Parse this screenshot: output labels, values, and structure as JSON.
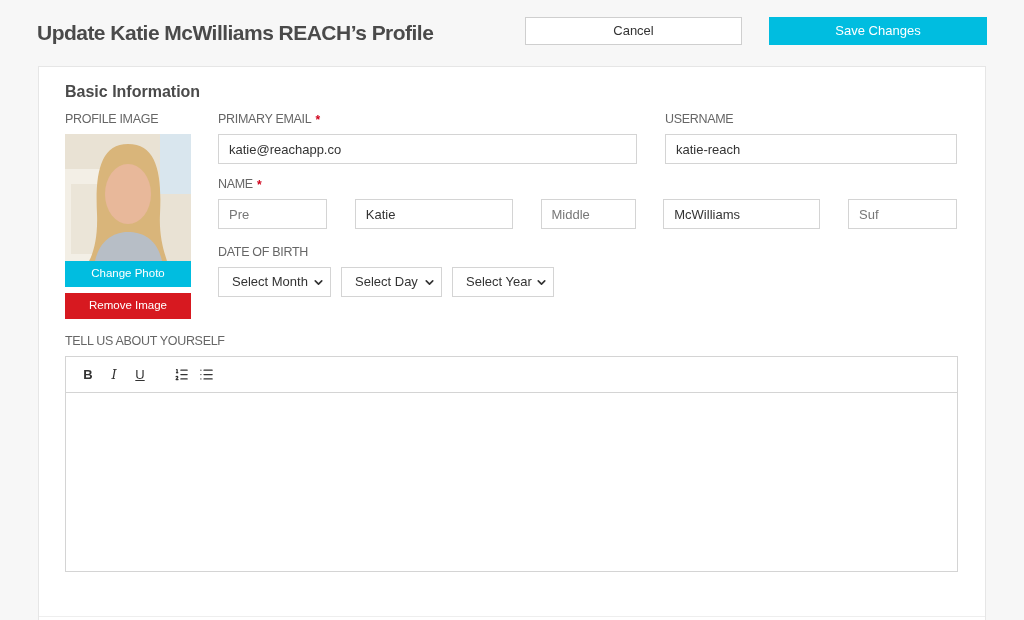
{
  "page": {
    "title": "Update Katie McWilliams REACH’s Profile"
  },
  "actions": [
    {
      "kind": "secondary",
      "label": "Cancel"
    },
    {
      "kind": "primary",
      "label": "Save Changes"
    }
  ],
  "section": {
    "title": "Basic Information"
  },
  "profile_image": {
    "label": "PROFILE IMAGE",
    "kind": "picture",
    "buttons": [
      {
        "kind": "change",
        "label": "Change Photo"
      },
      {
        "kind": "remove",
        "label": "Remove Image"
      }
    ]
  },
  "primary_email": {
    "label": "PRIMARY EMAIL",
    "required_mark": "*",
    "value": "katie@reachapp.co"
  },
  "username": {
    "label": "USERNAME",
    "value": "katie-reach"
  },
  "name": {
    "label": "NAME",
    "required_mark": "*",
    "fields": [
      {
        "placeholder": "Pre"
      },
      {
        "value": "Katie"
      },
      {
        "placeholder": "Middle"
      },
      {
        "value": "McWilliams"
      },
      {
        "placeholder": "Suf"
      }
    ]
  },
  "date_of_birth": {
    "label": "DATE OF BIRTH",
    "selects": [
      {
        "value": "Select Month"
      },
      {
        "value": "Select Day"
      },
      {
        "value": "Select Year"
      }
    ]
  },
  "about": {
    "label": "TELL US ABOUT YOURSELF",
    "toolbar": [
      {
        "kind": "bold",
        "label": "B"
      },
      {
        "kind": "italic",
        "label": "I"
      },
      {
        "kind": "underline",
        "label": "U"
      },
      {
        "kind": "ordered-list"
      },
      {
        "kind": "bullet-list"
      }
    ]
  }
}
